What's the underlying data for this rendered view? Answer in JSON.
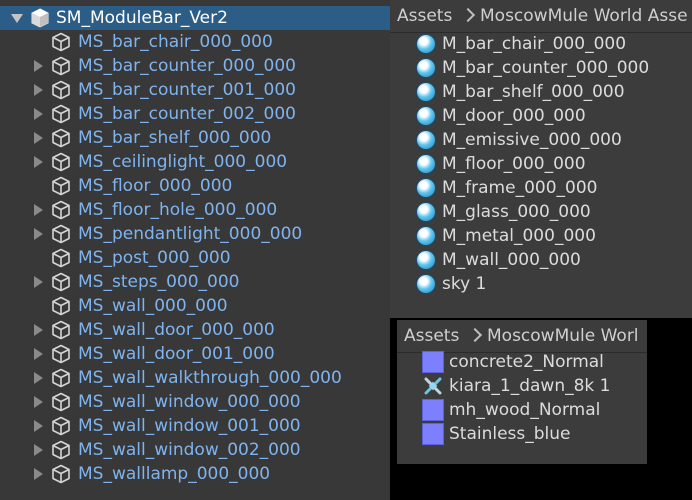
{
  "hierarchy": {
    "root": {
      "label": "SM_ModuleBar_Ver2",
      "icon": "prefab-cube-icon"
    },
    "items": [
      {
        "label": "MS_bar_chair_000_000",
        "expandable": false
      },
      {
        "label": "MS_bar_counter_000_000",
        "expandable": true
      },
      {
        "label": "MS_bar_counter_001_000",
        "expandable": true
      },
      {
        "label": "MS_bar_counter_002_000",
        "expandable": true
      },
      {
        "label": "MS_bar_shelf_000_000",
        "expandable": true
      },
      {
        "label": "MS_ceilinglight_000_000",
        "expandable": true
      },
      {
        "label": "MS_floor_000_000",
        "expandable": false
      },
      {
        "label": "MS_floor_hole_000_000",
        "expandable": true
      },
      {
        "label": "MS_pendantlight_000_000",
        "expandable": true
      },
      {
        "label": "MS_post_000_000",
        "expandable": false
      },
      {
        "label": "MS_steps_000_000",
        "expandable": true
      },
      {
        "label": "MS_wall_000_000",
        "expandable": false
      },
      {
        "label": "MS_wall_door_000_000",
        "expandable": true
      },
      {
        "label": "MS_wall_door_001_000",
        "expandable": true
      },
      {
        "label": "MS_wall_walkthrough_000_000",
        "expandable": true
      },
      {
        "label": "MS_wall_window_000_000",
        "expandable": true
      },
      {
        "label": "MS_wall_window_001_000",
        "expandable": true
      },
      {
        "label": "MS_wall_window_002_000",
        "expandable": true
      },
      {
        "label": "MS_walllamp_000_000",
        "expandable": true
      }
    ]
  },
  "materials_panel": {
    "breadcrumb": {
      "root": "Assets",
      "folder": "MoscowMule World Asse"
    },
    "items": [
      "M_bar_chair_000_000",
      "M_bar_counter_000_000",
      "M_bar_shelf_000_000",
      "M_door_000_000",
      "M_emissive_000_000",
      "M_floor_000_000",
      "M_frame_000_000",
      "M_glass_000_000",
      "M_metal_000_000",
      "M_wall_000_000",
      "sky 1"
    ]
  },
  "textures_panel": {
    "breadcrumb": {
      "root": "Assets",
      "folder": "MoscowMule Worl"
    },
    "items": [
      {
        "label": "concrete2_Normal",
        "icon": "texture-swatch-icon"
      },
      {
        "label": "kiara_1_dawn_8k 1",
        "icon": "hdr-texture-icon"
      },
      {
        "label": "mh_wood_Normal",
        "icon": "texture-swatch-icon"
      },
      {
        "label": "Stainless_blue",
        "icon": "texture-swatch-icon"
      }
    ]
  },
  "colors": {
    "selection": "#2c5d87",
    "prefab_text": "#7fb4f0",
    "panel_bg": "#383838",
    "texture_swatch": "#7c80ff"
  }
}
